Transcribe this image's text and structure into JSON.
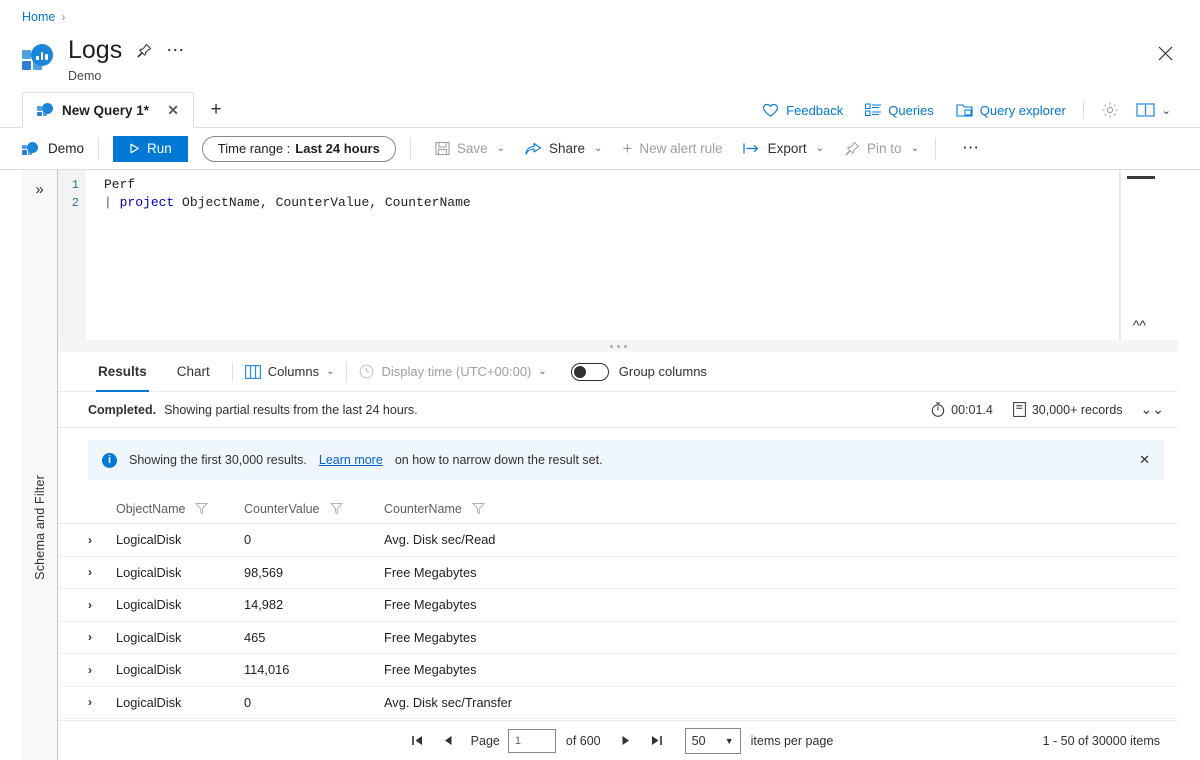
{
  "breadcrumb": {
    "home": "Home",
    "separator": "›"
  },
  "header": {
    "title": "Logs",
    "subtitle": "Demo",
    "pin_icon": "pin-icon",
    "more_icon": "ellipsis-icon",
    "close_icon": "close-icon"
  },
  "tabs": {
    "query_tab_label": "New Query 1*",
    "close_label": "✕",
    "add_label": "+",
    "actions": [
      {
        "label": "Feedback",
        "icon": "heart-icon"
      },
      {
        "label": "Queries",
        "icon": "list-icon"
      },
      {
        "label": "Query explorer",
        "icon": "folder-query-icon"
      }
    ],
    "settings_icon": "gear-icon",
    "book_icon": "book-icon",
    "book_chevron": "⌄"
  },
  "commandbar": {
    "scope": "Demo",
    "run_label": "Run",
    "run_icon": "play-icon",
    "time_range_label": "Time range :",
    "time_range_value": "Last 24 hours",
    "items": [
      {
        "label": "Save",
        "icon": "save-icon",
        "caret": "⌄",
        "disabled": true
      },
      {
        "label": "Share",
        "icon": "share-icon",
        "caret": "⌄",
        "disabled": false
      },
      {
        "label": "New alert rule",
        "icon": "plus-icon",
        "caret": "",
        "disabled": true
      },
      {
        "label": "Export",
        "icon": "export-icon",
        "caret": "⌄",
        "disabled": false
      },
      {
        "label": "Pin to",
        "icon": "pin-icon",
        "caret": "⌄",
        "disabled": true
      }
    ],
    "more_label": "⋯"
  },
  "sidebar": {
    "expand_icon": "chevron-double-right-icon",
    "label": "Schema and Filter"
  },
  "editor": {
    "lines": [
      {
        "number": "1",
        "text": "Perf",
        "keyword": "",
        "pipe": ""
      },
      {
        "number": "2",
        "text": " ObjectName, CounterValue, CounterName",
        "keyword": "project",
        "pipe": "|"
      }
    ],
    "collapse_icon": "chevron-double-up-icon"
  },
  "results": {
    "tabs": [
      {
        "label": "Results",
        "active": true
      },
      {
        "label": "Chart",
        "active": false
      }
    ],
    "columns_label": "Columns",
    "columns_icon": "columns-icon",
    "columns_caret": "⌄",
    "display_time_label": "Display time (UTC+00:00)",
    "display_time_icon": "clock-icon",
    "display_time_caret": "⌄",
    "group_columns_label": "Group columns",
    "group_columns_on": false,
    "status_bold": "Completed.",
    "status_text": "Showing partial results from the last 24 hours.",
    "duration": "00:01.4",
    "duration_icon": "timer-icon",
    "records": "30,000+ records",
    "records_icon": "records-icon",
    "expand_caret": "ˇˇ",
    "info": {
      "icon": "info-icon",
      "text_before": "Showing the first 30,000 results.",
      "link": "Learn more",
      "text_after": "on how to narrow down the result set.",
      "close": "✕"
    }
  },
  "grid": {
    "columns": [
      {
        "name": "ObjectName",
        "filter_icon": "filter-icon"
      },
      {
        "name": "CounterValue",
        "filter_icon": "filter-icon"
      },
      {
        "name": "CounterName",
        "filter_icon": "filter-icon"
      }
    ],
    "expand_glyph": "›",
    "rows": [
      {
        "ObjectName": "LogicalDisk",
        "CounterValue": "0",
        "CounterName": "Avg. Disk sec/Read"
      },
      {
        "ObjectName": "LogicalDisk",
        "CounterValue": "98,569",
        "CounterName": "Free Megabytes"
      },
      {
        "ObjectName": "LogicalDisk",
        "CounterValue": "14,982",
        "CounterName": "Free Megabytes"
      },
      {
        "ObjectName": "LogicalDisk",
        "CounterValue": "465",
        "CounterName": "Free Megabytes"
      },
      {
        "ObjectName": "LogicalDisk",
        "CounterValue": "114,016",
        "CounterName": "Free Megabytes"
      },
      {
        "ObjectName": "LogicalDisk",
        "CounterValue": "0",
        "CounterName": "Avg. Disk sec/Transfer"
      }
    ]
  },
  "pager": {
    "first": "⏮",
    "prev": "◀",
    "page_label": "Page",
    "page_value": "1",
    "of_label": "of 600",
    "next": "▶",
    "last": "⏭",
    "page_size": "50",
    "page_size_caret": "▼",
    "items_per_page": "items per page",
    "range": "1 - 50 of 30000 items"
  },
  "colors": {
    "accent": "#0078d4",
    "info_bg": "#eff6fc",
    "link": "#0066cc",
    "border": "#e1dfdd"
  }
}
